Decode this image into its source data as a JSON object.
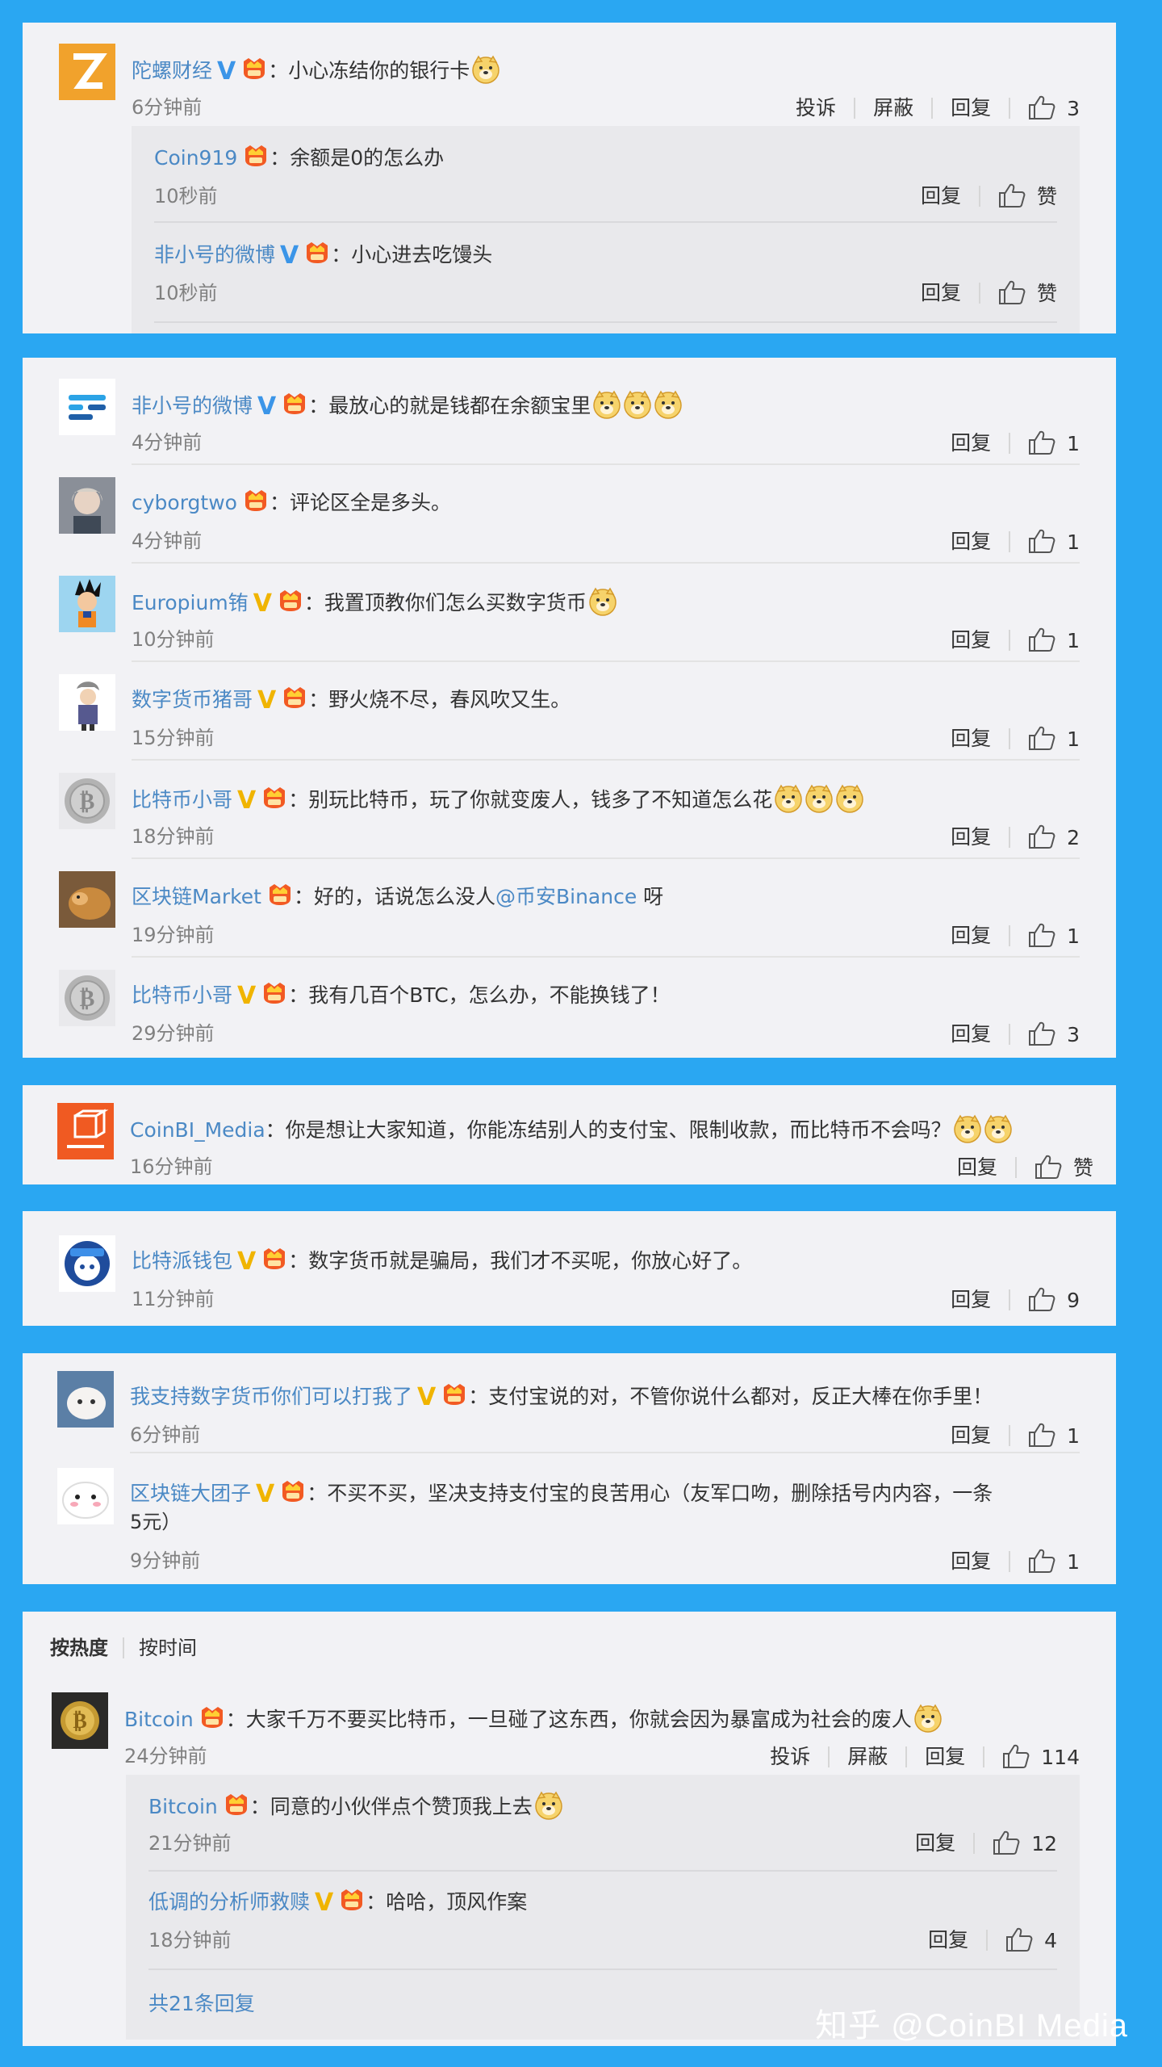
{
  "icons": {
    "thumb": "thumb-up-icon",
    "vip": "vip-badge-icon",
    "vb": "verified-blue-v-icon",
    "vy": "verified-yellow-v-icon",
    "emoji": "doge-emoji-icon"
  },
  "labels": {
    "report": "投诉",
    "block": "屏蔽",
    "reply": "回复",
    "like": "赞"
  },
  "card1": {
    "main": {
      "user": "陀螺财经",
      "text": "：小心冻结你的银行卡",
      "time": "6分钟前",
      "likes": "3"
    },
    "replies": [
      {
        "user": "Coin919",
        "text": "：余额是0的怎么办",
        "time": "10秒前",
        "likes": "赞"
      },
      {
        "user": "非小号的微博",
        "text": "：小心进去吃馒头",
        "time": "10秒前",
        "likes": "赞"
      }
    ]
  },
  "card2": [
    {
      "user": "非小号的微博",
      "text": "：最放心的就是钱都在余额宝里",
      "time": "4分钟前",
      "likes": "1"
    },
    {
      "user": "cyborgtwo",
      "text": "：评论区全是多头。",
      "time": "4分钟前",
      "likes": "1"
    },
    {
      "user": "Europium铕",
      "text": "：我置顶教你们怎么买数字货币",
      "time": "10分钟前",
      "likes": "1"
    },
    {
      "user": "数字货币猪哥",
      "text": "：野火烧不尽，春风吹又生。",
      "time": "15分钟前",
      "likes": "1"
    },
    {
      "user": "比特币小哥",
      "text": "：别玩比特币，玩了你就变废人，钱多了不知道怎么花",
      "time": "18分钟前",
      "likes": "2"
    },
    {
      "user": "区块链Market",
      "text": "：好的，话说怎么没人",
      "mention": "@币安Binance",
      "text2": " 呀",
      "time": "19分钟前",
      "likes": "1"
    },
    {
      "user": "比特币小哥",
      "text": "：我有几百个BTC，怎么办，不能换钱了！",
      "time": "29分钟前",
      "likes": "3"
    }
  ],
  "card3": {
    "user": "CoinBI_Media",
    "text": "：你是想让大家知道，你能冻结别人的支付宝、限制收款，而比特币不会吗？",
    "time": "16分钟前",
    "likes": "赞"
  },
  "card4": {
    "user": "比特派钱包",
    "text": "：数字货币就是骗局，我们才不买呢，你放心好了。",
    "time": "11分钟前",
    "likes": "9"
  },
  "card5": [
    {
      "user": "我支持数字货币你们可以打我了",
      "text": "：支付宝说的对，不管你说什么都对，反正大棒在你手里！",
      "time": "6分钟前",
      "likes": "1"
    },
    {
      "user": "区块链大团子",
      "text": "：不买不买，坚决支持支付宝的良苦用心（友军口吻，删除括号内内容，一条",
      "text_cont": "5元）",
      "time": "9分钟前",
      "likes": "1"
    }
  ],
  "card6": {
    "sort_hot": "按热度",
    "sort_time": "按时间",
    "main": {
      "user": "Bitcoin",
      "text": "：大家千万不要买比特币，一旦碰了这东西，你就会因为暴富成为社会的废人",
      "time": "24分钟前",
      "likes": "114"
    },
    "replies": [
      {
        "user": "Bitcoin",
        "text": "：同意的小伙伴点个赞顶我上去",
        "time": "21分钟前",
        "likes": "12"
      },
      {
        "user": "低调的分析师救赎",
        "text": "：哈哈，顶风作案",
        "time": "18分钟前",
        "likes": "4"
      }
    ],
    "more": "共21条回复"
  },
  "watermark": "知乎 @CoinBI Media"
}
